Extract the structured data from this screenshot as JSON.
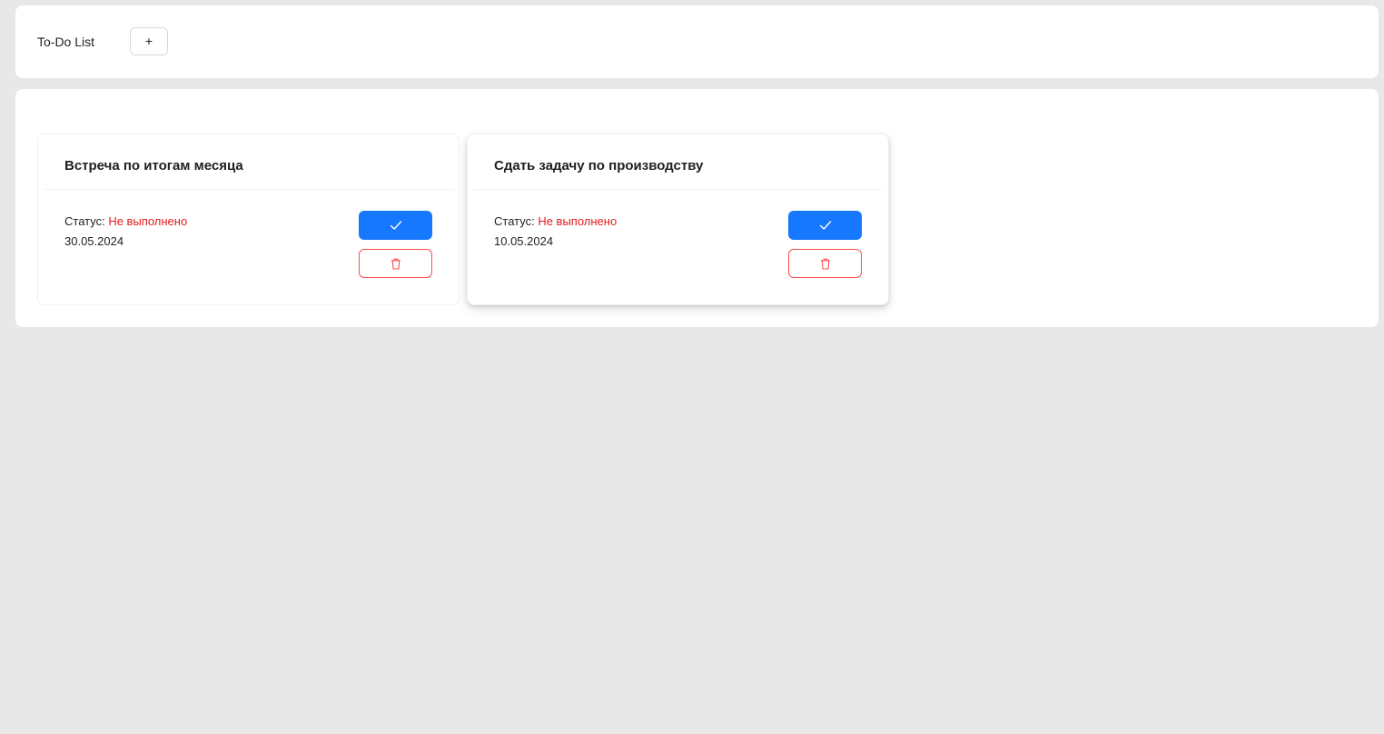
{
  "header": {
    "title": "To-Do List",
    "add_label": "+"
  },
  "tasks": [
    {
      "title": "Встреча по итогам месяца",
      "status_label": "Статус: ",
      "status_value": "Не выполнено",
      "date": "30.05.2024"
    },
    {
      "title": "Сдать задачу по производству",
      "status_label": "Статус: ",
      "status_value": "Не выполнено",
      "date": "10.05.2024"
    }
  ],
  "icons": {
    "done": "check-icon",
    "delete": "trash-icon"
  },
  "colors": {
    "primary": "#1677ff",
    "danger": "#ff4d4f",
    "status_red": "#e31b1b",
    "background": "#e8e8e8"
  }
}
